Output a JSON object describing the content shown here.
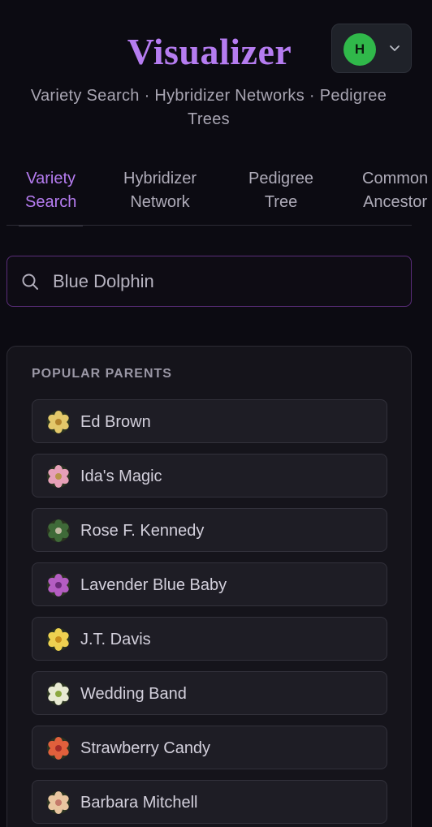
{
  "header": {
    "brand": "Visualizer",
    "subtitle": "Variety Search · Hybridizer Networks · Pedigree Trees",
    "user": {
      "initial": "H",
      "avatar_color": "#30b84a",
      "menu_icon": "chevron-down-icon"
    }
  },
  "tabs": [
    {
      "line1": "Variety",
      "line2": "Search",
      "active": true
    },
    {
      "line1": "Hybridizer",
      "line2": "Network",
      "active": false
    },
    {
      "line1": "Pedigree",
      "line2": "Tree",
      "active": false
    },
    {
      "line1": "Common",
      "line2": "Ancestor",
      "active": false
    }
  ],
  "search": {
    "value": "Blue Dolphin",
    "icon": "search-icon"
  },
  "popular_parents": {
    "title": "POPULAR PARENTS",
    "items": [
      {
        "label": "Ed Brown",
        "icon": "flower-thumbnail",
        "petal": "#e3c86a",
        "center": "#b3842c"
      },
      {
        "label": "Ida's Magic",
        "icon": "flower-thumbnail",
        "petal": "#e6a0b8",
        "center": "#b8944a"
      },
      {
        "label": "Rose F. Kennedy",
        "icon": "flower-thumbnail",
        "petal": "#3f6a38",
        "center": "#c2b8a2"
      },
      {
        "label": "Lavender Blue Baby",
        "icon": "flower-thumbnail",
        "petal": "#b45dc2",
        "center": "#6a2b78"
      },
      {
        "label": "J.T. Davis",
        "icon": "flower-thumbnail",
        "petal": "#eed150",
        "center": "#c98f1c"
      },
      {
        "label": "Wedding Band",
        "icon": "flower-thumbnail",
        "petal": "#e8ead2",
        "center": "#8ca840"
      },
      {
        "label": "Strawberry Candy",
        "icon": "flower-thumbnail",
        "petal": "#e0603c",
        "center": "#a52c28"
      },
      {
        "label": "Barbara Mitchell",
        "icon": "flower-thumbnail",
        "petal": "#e9c6a0",
        "center": "#c47a6a"
      }
    ]
  },
  "colors": {
    "accent": "#b57cf0",
    "background": "#0c0b12",
    "panel": "#15141b",
    "item": "#1e1d25",
    "search_border": "#5a2d7a"
  }
}
